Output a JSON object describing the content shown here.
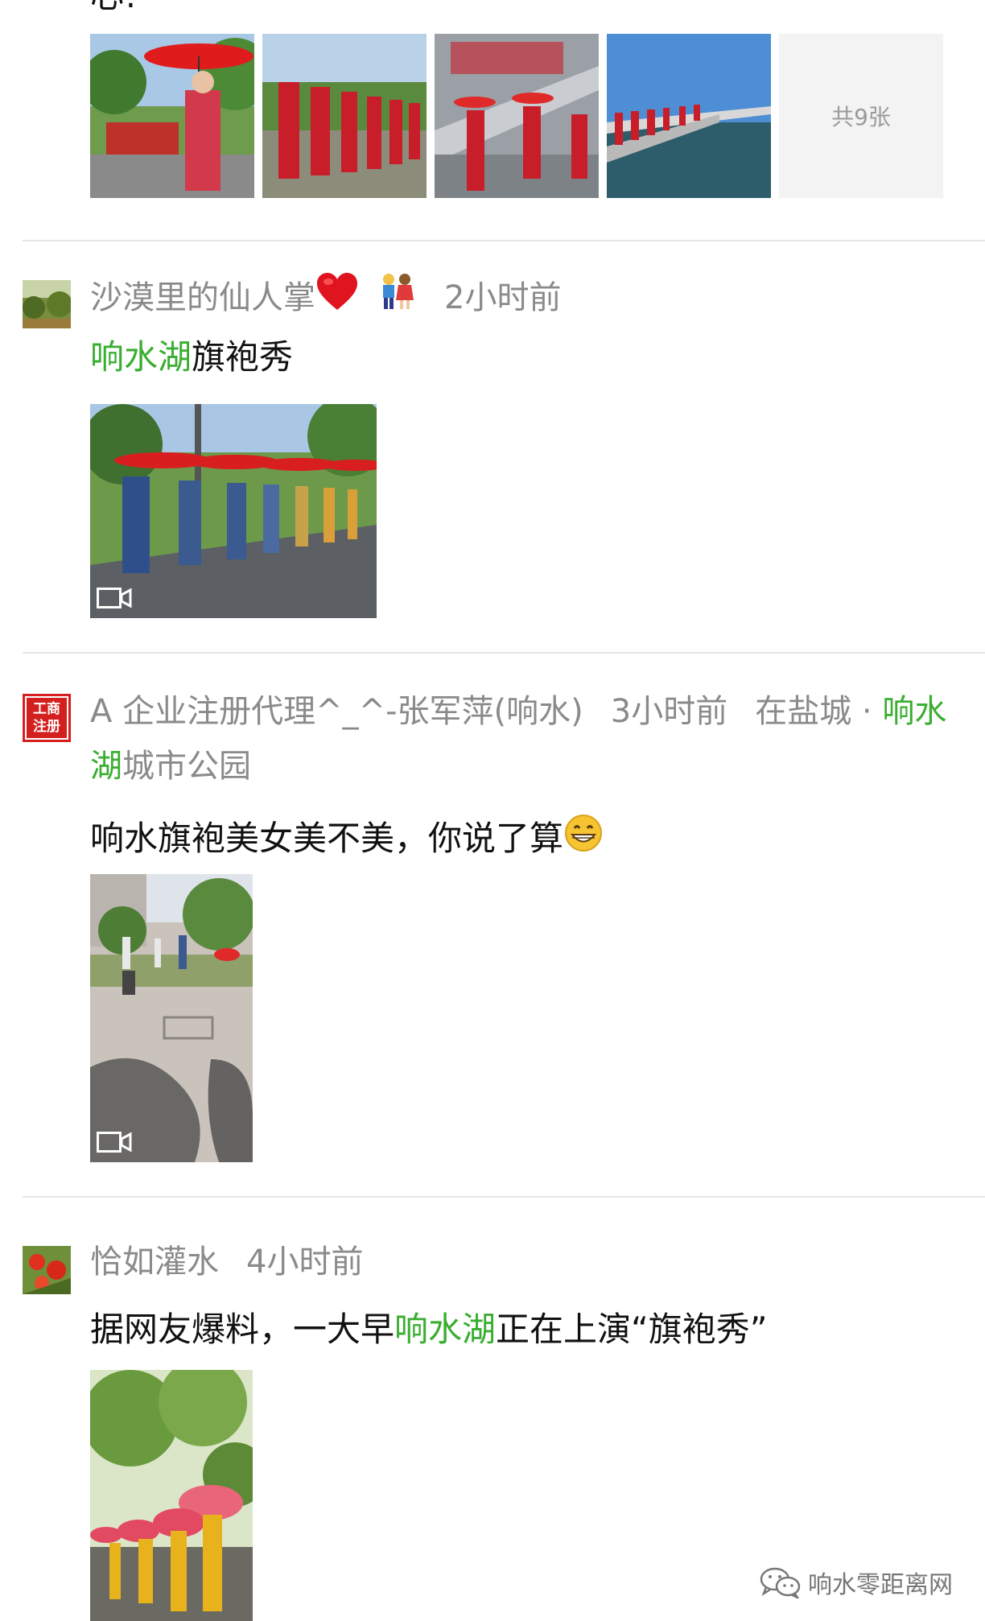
{
  "top": {
    "cut_text": "心!",
    "more_label": "共9张"
  },
  "posts": [
    {
      "user": "沙漠里的仙人掌",
      "time": "2小时前",
      "link": "响水湖",
      "text": "旗袍秀",
      "icons": [
        "red-heart-icon",
        "couple-icon"
      ]
    },
    {
      "user": "A 企业注册代理^_^-张军萍(响水)",
      "time": "3小时前",
      "location_prefix": "在盐城 · ",
      "location_link": "响水湖",
      "location_suffix": "城市公园",
      "avatar_text_1": "工商",
      "avatar_text_2": "注册",
      "text": "响水旗袍美女美不美，你说了算"
    },
    {
      "user": "恰如灌水",
      "time": "4小时前",
      "text_before": "据网友爆料，一大早",
      "link": "响水湖",
      "text_after": "正在上演“旗袍秀”"
    }
  ],
  "watermark": {
    "label": "响水零距离网",
    "icon": "wechat-icon"
  },
  "colors": {
    "link_green": "#3aae31",
    "meta_gray": "#8a8a8a",
    "divider": "#e5e5e5"
  }
}
